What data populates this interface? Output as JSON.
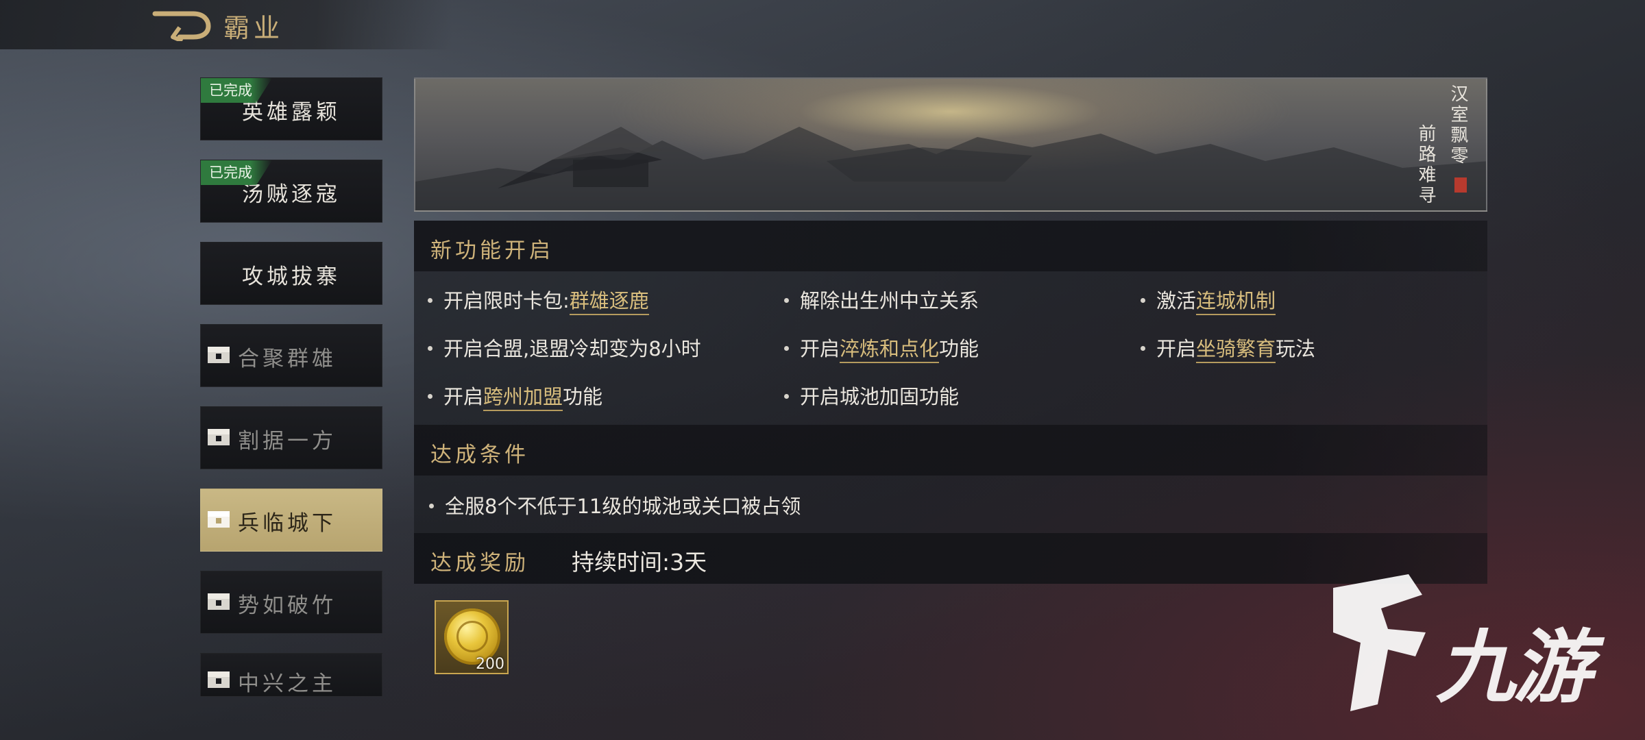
{
  "header": {
    "title": "霸业",
    "back_icon": "back-arrow-icon"
  },
  "sidebar": {
    "items": [
      {
        "label": "英雄露颖",
        "badge": "已完成",
        "state": "completed"
      },
      {
        "label": "汤贼逐寇",
        "badge": "已完成",
        "state": "completed"
      },
      {
        "label": "攻城拔寨",
        "state": "unlocked"
      },
      {
        "label": "合聚群雄",
        "state": "locked",
        "icon": "chest-icon"
      },
      {
        "label": "割据一方",
        "state": "locked",
        "icon": "chest-icon"
      },
      {
        "label": "兵临城下",
        "state": "selected",
        "icon": "chest-icon"
      },
      {
        "label": "势如破竹",
        "state": "locked",
        "icon": "chest-icon"
      },
      {
        "label": "中兴之主",
        "state": "locked",
        "icon": "chest-icon"
      }
    ]
  },
  "banner": {
    "line1": "汉室飘零",
    "line2": "前路难寻"
  },
  "features": {
    "title": "新功能开启",
    "items": [
      {
        "pre": "开启限时卡包:",
        "link": "群雄逐鹿",
        "post": ""
      },
      {
        "pre": "解除出生州中立关系",
        "link": "",
        "post": ""
      },
      {
        "pre": "激活",
        "link": "连城机制",
        "post": ""
      },
      {
        "pre": "开启合盟,退盟冷却变为8小时",
        "link": "",
        "post": ""
      },
      {
        "pre": "开启",
        "link": "淬炼和点化",
        "post": "功能"
      },
      {
        "pre": "开启",
        "link": "坐骑繁育",
        "post": "玩法"
      },
      {
        "pre": "开启",
        "link": "跨州加盟",
        "post": "功能"
      },
      {
        "pre": "开启城池加固功能",
        "link": "",
        "post": ""
      }
    ]
  },
  "conditions": {
    "title": "达成条件",
    "items": [
      "全服8个不低于11级的城池或关口被占领"
    ]
  },
  "rewards": {
    "title": "达成奖励",
    "duration": "持续时间:3天",
    "items": [
      {
        "icon": "gold-coin-icon",
        "count": "200"
      }
    ]
  },
  "watermark": {
    "text": "九游",
    "logo": "jiuyou-logo-icon"
  },
  "colors": {
    "accent_gold": "#cfb37a",
    "completed_green": "#2f7a3e",
    "selected_tab": "#c9b885"
  }
}
